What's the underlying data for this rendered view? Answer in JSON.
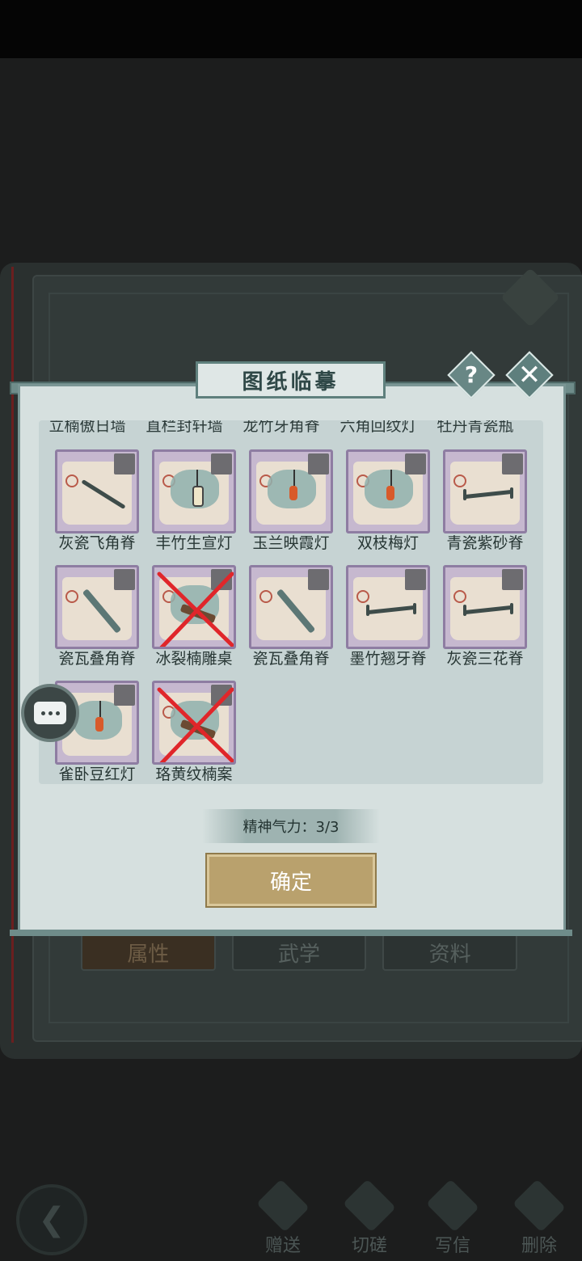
{
  "dialog": {
    "title": "图纸临摹",
    "help_label": "?",
    "close_label": "✕",
    "energy_text": "精神气力：3/3",
    "confirm_label": "确定"
  },
  "partial_row_labels": [
    "立楠傲日墙",
    "直栏封轩墙",
    "龙竹牙角脊",
    "六角回纹灯",
    "牡丹青瓷瓶"
  ],
  "items": [
    {
      "label": "灰瓷飞角脊",
      "icon": "curved-ridge-icon",
      "crossed": false
    },
    {
      "label": "丰竹生宣灯",
      "icon": "hanging-lantern-icon",
      "crossed": false
    },
    {
      "label": "玉兰映霞灯",
      "icon": "red-lantern-icon",
      "crossed": false
    },
    {
      "label": "双枝梅灯",
      "icon": "lantern-icon",
      "crossed": false
    },
    {
      "label": "青瓷紫砂脊",
      "icon": "ridge-beam-icon",
      "crossed": false
    },
    {
      "label": "瓷瓦叠角脊",
      "icon": "tile-ridge-icon",
      "crossed": false
    },
    {
      "label": "冰裂楠雕桌",
      "icon": "carved-table-icon",
      "crossed": true
    },
    {
      "label": "瓷瓦叠角脊",
      "icon": "tile-ridge-icon",
      "crossed": false
    },
    {
      "label": "墨竹翘牙脊",
      "icon": "ridge-beam-icon",
      "crossed": false
    },
    {
      "label": "灰瓷三花脊",
      "icon": "ridge-beam-icon",
      "crossed": false
    },
    {
      "label": "雀卧豆红灯",
      "icon": "lantern-icon",
      "crossed": false
    },
    {
      "label": "珞黄纹楠案",
      "icon": "carved-table-icon",
      "crossed": true
    }
  ],
  "background": {
    "tabs": [
      "属性",
      "武学",
      "资料"
    ],
    "bottom_actions": [
      "赠送",
      "切磋",
      "写信",
      "删除"
    ]
  }
}
